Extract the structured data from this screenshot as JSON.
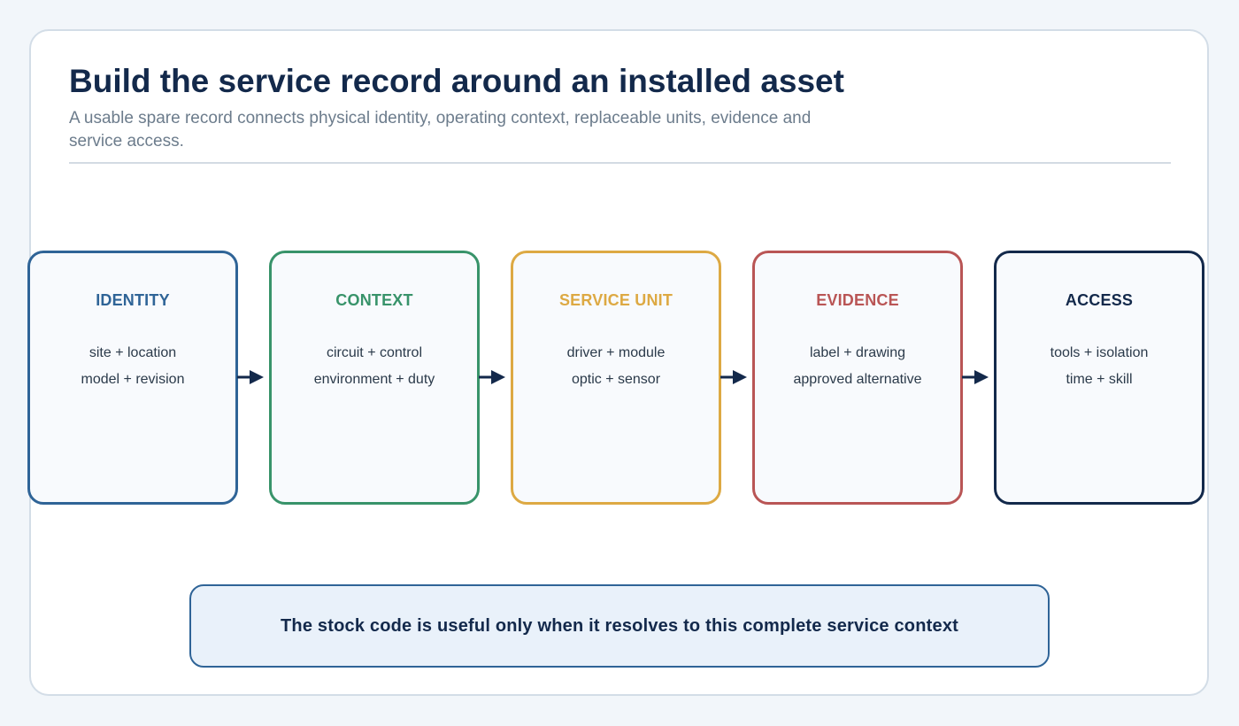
{
  "header": {
    "title": "Build the service record around an installed asset",
    "subtitle": "A usable spare record connects physical identity, operating context, replaceable units, evidence and service access."
  },
  "stages": [
    {
      "label": "IDENTITY",
      "line1": "site + location",
      "line2": "model + revision",
      "color": "#2f6497"
    },
    {
      "label": "CONTEXT",
      "line1": "circuit + control",
      "line2": "environment + duty",
      "color": "#38936a"
    },
    {
      "label": "SERVICE UNIT",
      "line1": "driver + module",
      "line2": "optic + sensor",
      "color": "#dda943"
    },
    {
      "label": "EVIDENCE",
      "line1": "label + drawing",
      "line2": "approved alternative",
      "color": "#b95555"
    },
    {
      "label": "ACCESS",
      "line1": "tools + isolation",
      "line2": "time + skill",
      "color": "#13294b"
    }
  ],
  "callout": {
    "text": "The stock code is useful only when it resolves to this complete service context"
  },
  "colors": {
    "arrow": "#13294b",
    "title": "#13294b",
    "callout_border": "#2f6497",
    "callout_fill": "#e9f1fa"
  }
}
